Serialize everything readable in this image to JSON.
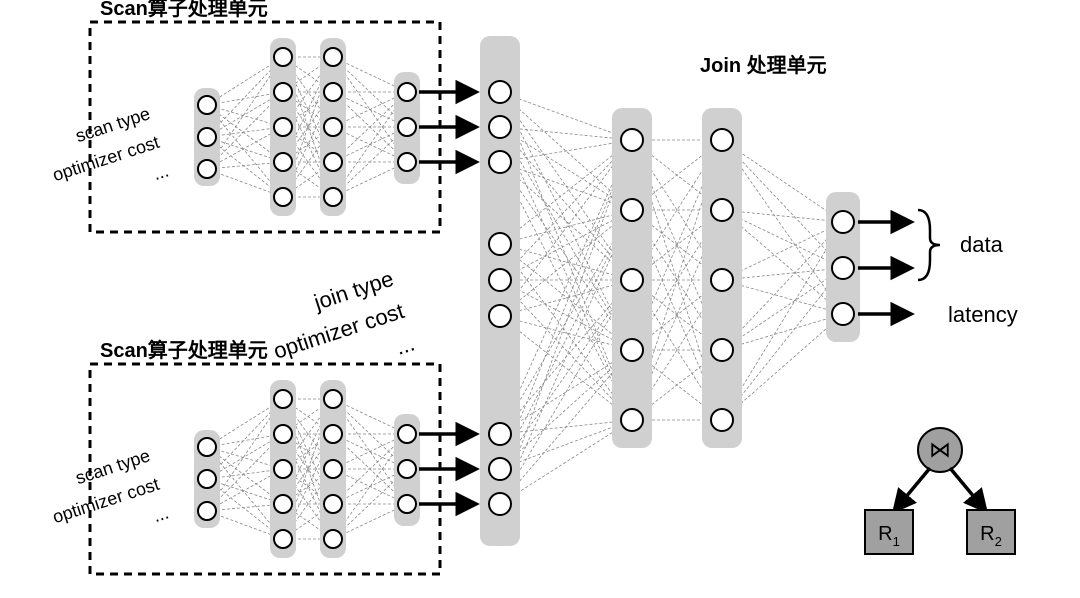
{
  "scan_unit_title": "Scan算子处理单元",
  "join_unit_title": "Join 处理单元",
  "scan_inputs": {
    "label1": "scan type",
    "label2": "optimizer cost",
    "label3": "..."
  },
  "join_inputs": {
    "label1": "join type",
    "label2": "optimizer cost",
    "label3": "..."
  },
  "outputs": {
    "data": "data",
    "latency": "latency"
  },
  "tree": {
    "root_symbol": "⋈",
    "left_leaf": "R",
    "left_sub": "1",
    "right_leaf": "R",
    "right_sub": "2"
  }
}
